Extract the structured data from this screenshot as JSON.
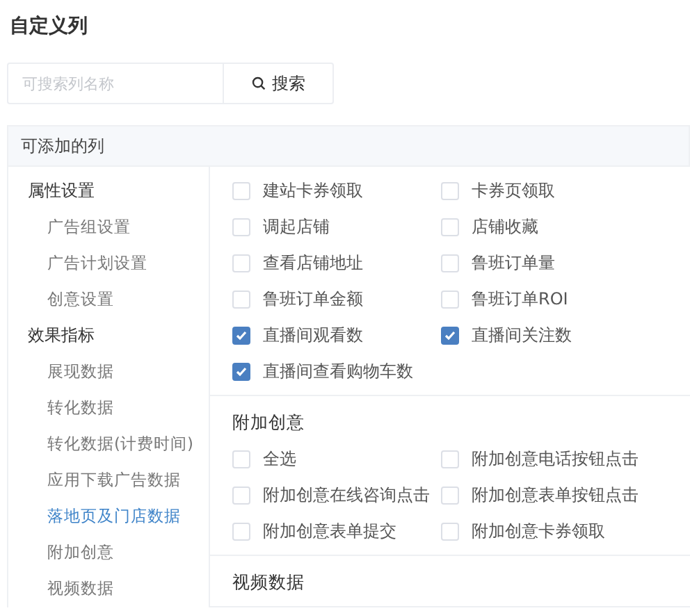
{
  "title": "自定义列",
  "search": {
    "placeholder": "可搜索列名称",
    "button": "搜索"
  },
  "available_header": "可添加的列",
  "sidebar": [
    {
      "label": "属性设置",
      "children": [
        {
          "label": "广告组设置",
          "selected": false
        },
        {
          "label": "广告计划设置",
          "selected": false
        },
        {
          "label": "创意设置",
          "selected": false
        }
      ]
    },
    {
      "label": "效果指标",
      "children": [
        {
          "label": "展现数据",
          "selected": false
        },
        {
          "label": "转化数据",
          "selected": false
        },
        {
          "label": "转化数据(计费时间)",
          "selected": false
        },
        {
          "label": "应用下载广告数据",
          "selected": false
        },
        {
          "label": "落地页及门店数据",
          "selected": true
        },
        {
          "label": "附加创意",
          "selected": false
        },
        {
          "label": "视频数据",
          "selected": false
        }
      ]
    }
  ],
  "sections": [
    {
      "options": [
        {
          "label": "建站卡券领取",
          "checked": false
        },
        {
          "label": "卡券页领取",
          "checked": false
        },
        {
          "label": "调起店铺",
          "checked": false
        },
        {
          "label": "店铺收藏",
          "checked": false
        },
        {
          "label": "查看店铺地址",
          "checked": false
        },
        {
          "label": "鲁班订单量",
          "checked": false
        },
        {
          "label": "鲁班订单金额",
          "checked": false
        },
        {
          "label": "鲁班订单ROI",
          "checked": false
        },
        {
          "label": "直播间观看数",
          "checked": true
        },
        {
          "label": "直播间关注数",
          "checked": true
        },
        {
          "label": "直播间查看购物车数",
          "checked": true
        }
      ]
    },
    {
      "title": "附加创意",
      "options": [
        {
          "label": "全选",
          "checked": false
        },
        {
          "label": "附加创意电话按钮点击",
          "checked": false
        },
        {
          "label": "附加创意在线咨询点击",
          "checked": false
        },
        {
          "label": "附加创意表单按钮点击",
          "checked": false
        },
        {
          "label": "附加创意表单提交",
          "checked": false
        },
        {
          "label": "附加创意卡券领取",
          "checked": false
        }
      ]
    },
    {
      "title": "视频数据"
    }
  ]
}
